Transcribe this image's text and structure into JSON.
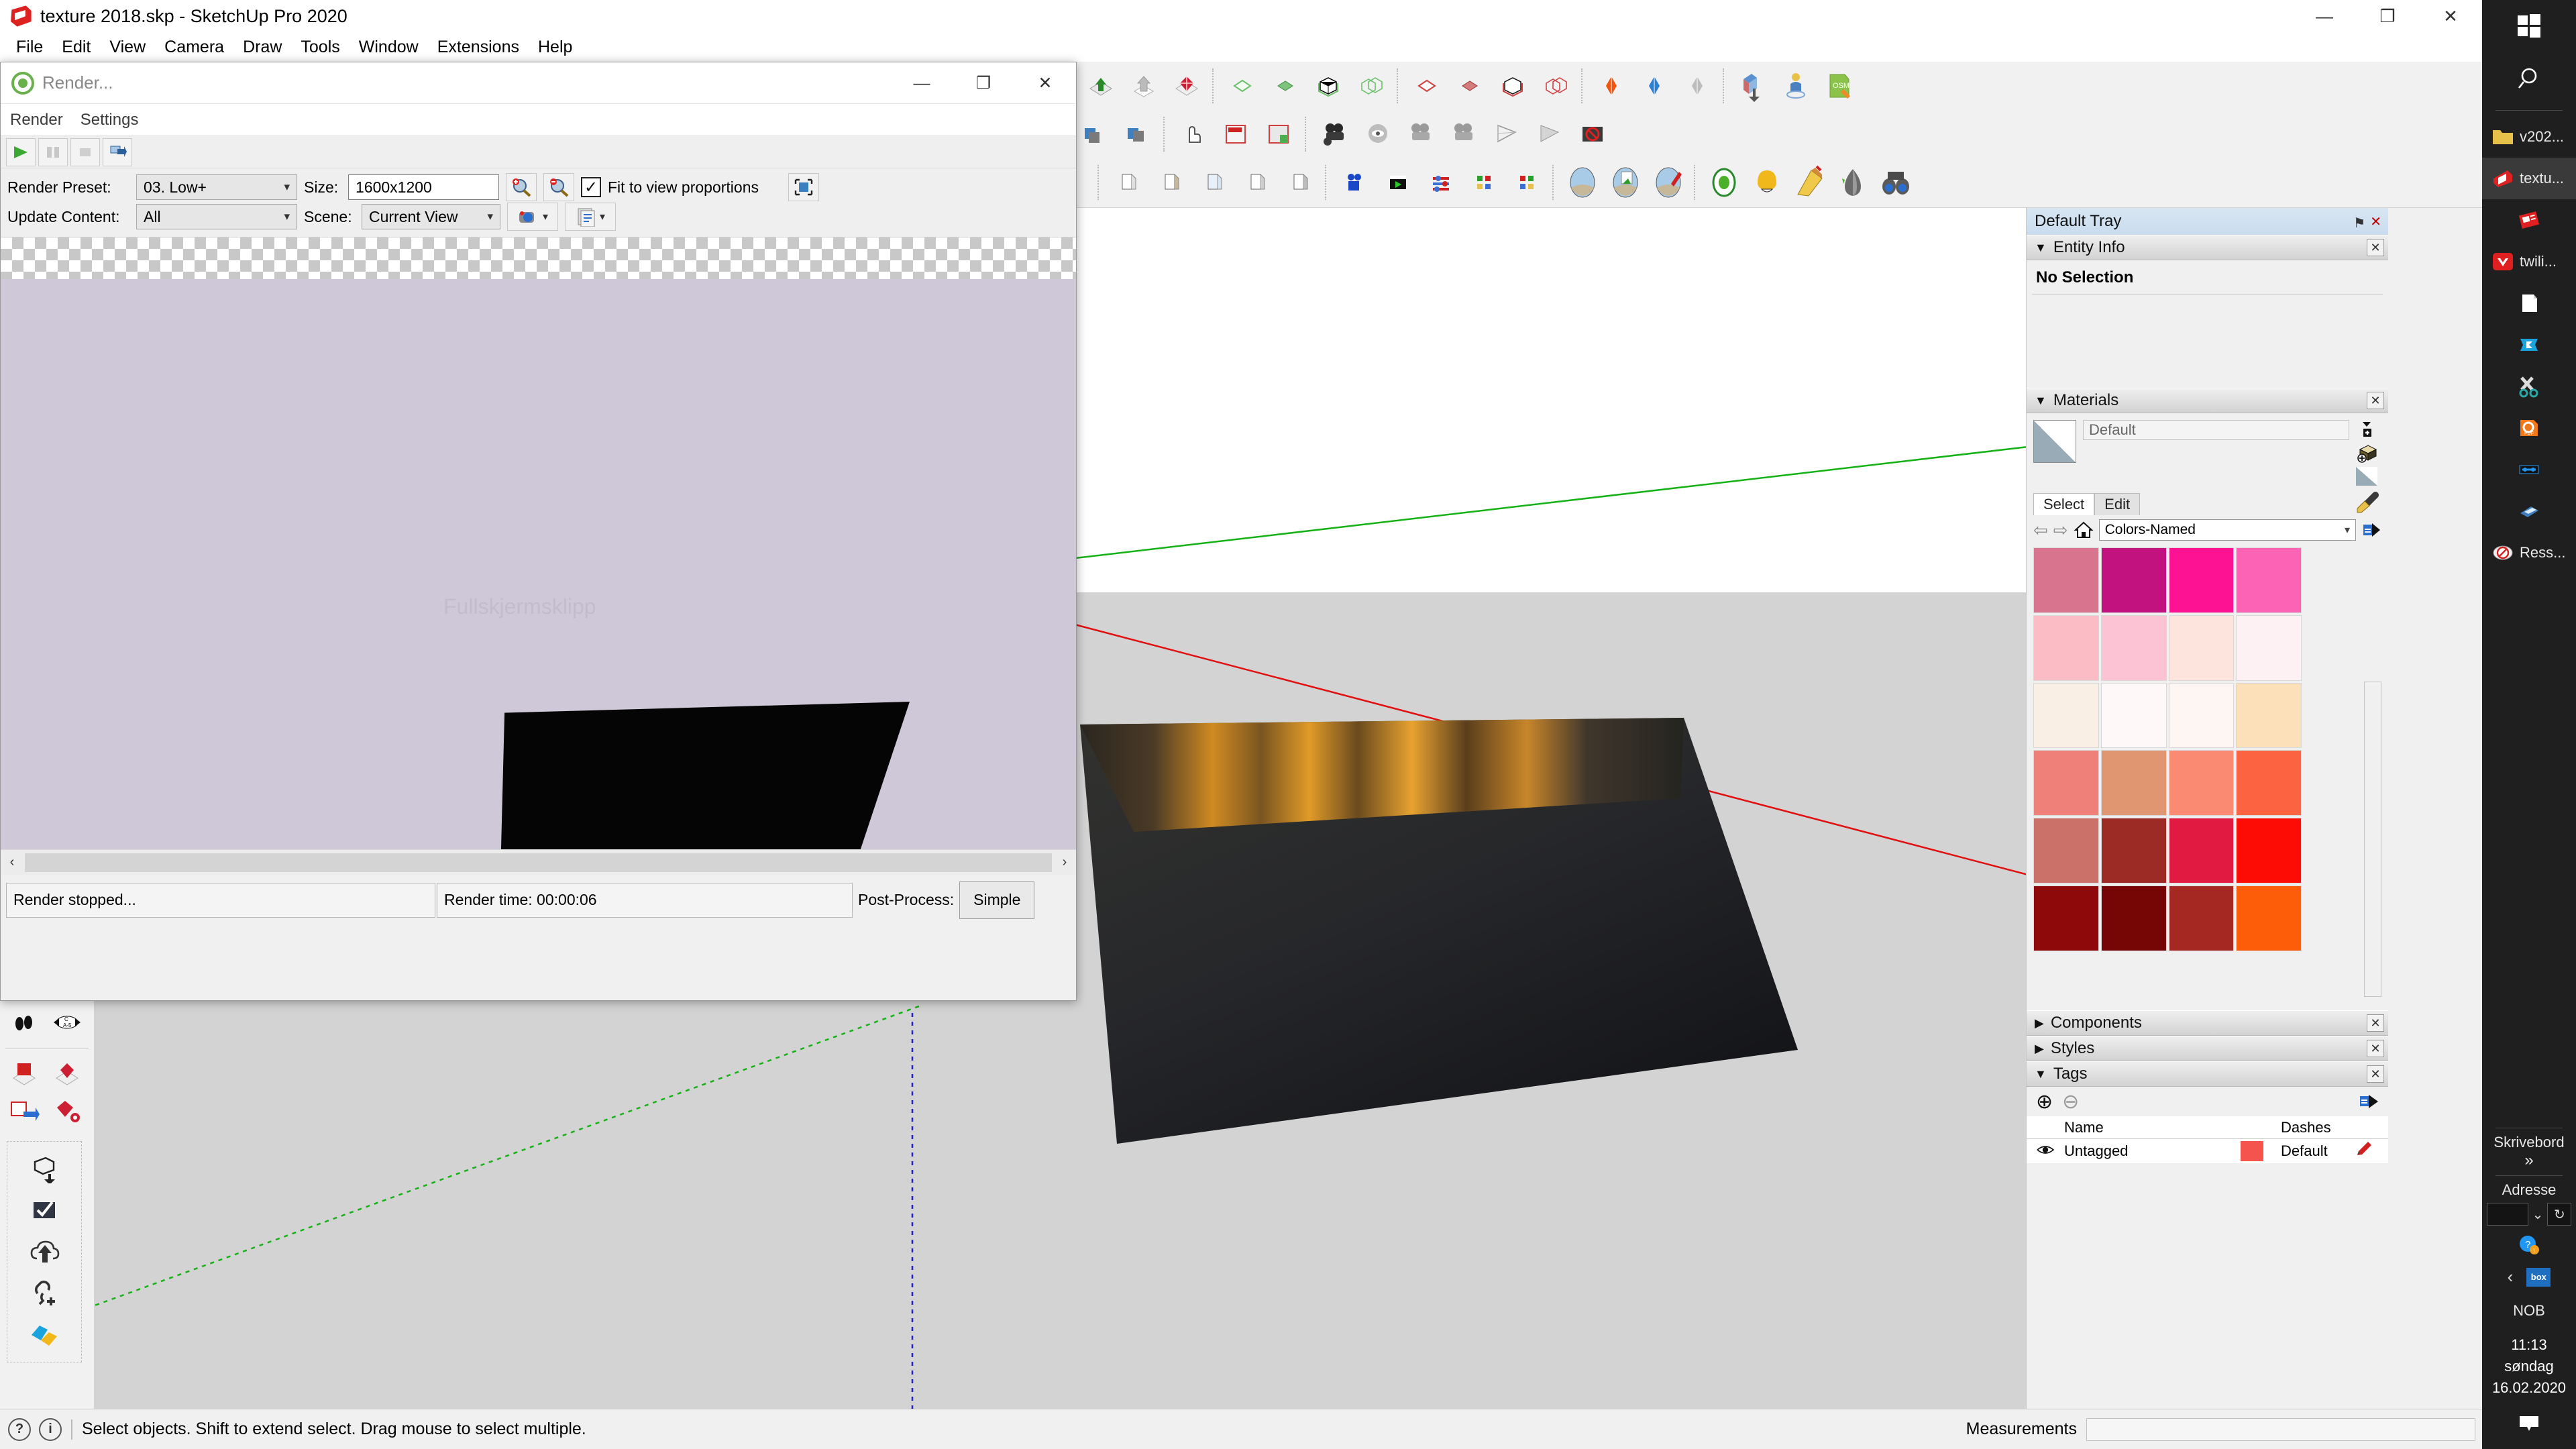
{
  "window": {
    "title": "texture 2018.skp - SketchUp Pro 2020",
    "minimize": "—",
    "maximize": "❐",
    "close": "✕"
  },
  "menubar": {
    "items": [
      "File",
      "Edit",
      "View",
      "Camera",
      "Draw",
      "Tools",
      "Window",
      "Extensions",
      "Help"
    ]
  },
  "render_dialog": {
    "title": "Render...",
    "minimize": "—",
    "maximize": "❐",
    "close": "✕",
    "menu": [
      "Render",
      "Settings"
    ],
    "render_preset_label": "Render Preset:",
    "render_preset_value": "03. Low+",
    "update_content_label": "Update Content:",
    "update_content_value": "All",
    "size_label": "Size:",
    "size_value": "1600x1200",
    "scene_label": "Scene:",
    "scene_value": "Current View",
    "fit_checkbox_label": "Fit to view proportions",
    "fit_checkbox_checked": "✓",
    "watermark": "Fullskjermsklipp",
    "status_message": "Render stopped...",
    "render_time": "Render time: 00:00:06",
    "post_process_label": "Post-Process:",
    "post_process_button": "Simple",
    "scroll_left": "‹",
    "scroll_right": "›"
  },
  "tray": {
    "title": "Default Tray",
    "pin_icon": "⚑",
    "close_icon": "✕",
    "collapse_down": "▼",
    "collapse_right": "▶",
    "panels": {
      "entity_info": {
        "title": "Entity Info",
        "content": "No Selection"
      },
      "materials": {
        "title": "Materials",
        "current_name": "Default",
        "tabs": [
          "Select",
          "Edit"
        ],
        "active_tab": "Select",
        "collection": "Colors-Named",
        "back_icon": "⇦",
        "forward_icon": "⇨",
        "home_icon": "⌂",
        "details_icon": "▶",
        "swatches": [
          "#d9748f",
          "#c2127f",
          "#fd1293",
          "#fd63b5",
          "#fcbcc5",
          "#fbc3d4",
          "#fde4dd",
          "#fdf1f4",
          "#faefe4",
          "#fef9f8",
          "#fef6f3",
          "#fce0b9",
          "#ee8079",
          "#e09671",
          "#fa8a72",
          "#fb6341",
          "#cb7169",
          "#9c2b25",
          "#e01a41",
          "#fd0c05",
          "#8e0a0a",
          "#760606",
          "#a52822",
          "#fd5c08"
        ]
      },
      "components": {
        "title": "Components"
      },
      "styles": {
        "title": "Styles"
      },
      "tags": {
        "title": "Tags",
        "add_icon": "⊕",
        "remove_icon": "⊖",
        "details_icon": "▶",
        "columns": [
          "Name",
          "Dashes"
        ],
        "rows": [
          {
            "visible_icon": "◉",
            "name": "Untagged",
            "color": "#f5534e",
            "dashes": "Default",
            "edit_icon": "✎"
          }
        ]
      }
    }
  },
  "statusbar": {
    "help_icon": "?",
    "info_icon": "i",
    "message": "Select objects. Shift to extend select. Drag mouse to select multiple.",
    "measurements_label": "Measurements",
    "measurements_value": ""
  },
  "taskbar": {
    "start_icon": "windows-logo",
    "search_icon": "search-icon",
    "apps": [
      {
        "label": "v202...",
        "icon": "folder-icon",
        "color": "#e8c14a",
        "active": false
      },
      {
        "label": "textu...",
        "icon": "sketchup-icon",
        "color": "#dd2222",
        "active": true
      },
      {
        "label": "",
        "icon": "pdf-reader-icon",
        "color": "#e02020",
        "active": false
      },
      {
        "label": "twili...",
        "icon": "twilight-render-icon",
        "color": "#e02020",
        "active": false
      },
      {
        "label": "",
        "icon": "document-icon",
        "color": "#ffffff",
        "active": false
      },
      {
        "label": "",
        "icon": "cleaner-icon",
        "color": "#1aa3dd",
        "active": false
      },
      {
        "label": "",
        "icon": "snipping-tool-icon",
        "color": "#2aa8a8",
        "active": false
      },
      {
        "label": "",
        "icon": "pdf-icon",
        "color": "#f07818",
        "active": false
      },
      {
        "label": "",
        "icon": "network-icon",
        "color": "#2196f3",
        "active": false
      },
      {
        "label": "",
        "icon": "scanner-icon",
        "color": "#3f7fc0",
        "active": false
      },
      {
        "label": "Ress...",
        "icon": "resource-monitor-icon",
        "color": "#e0e0e0",
        "active": false
      }
    ],
    "desktop_label": "Skrivebord",
    "desktop_chevron": "»",
    "address_label": "Adresse",
    "refresh_icon": "↻",
    "chevron_down": "⌄",
    "help_icon": "?",
    "tray_expand": "‹",
    "box_icon": "box",
    "language": "NOB",
    "time": "11:13",
    "day": "søndag",
    "date": "16.02.2020",
    "notification_icon": "⌸"
  }
}
